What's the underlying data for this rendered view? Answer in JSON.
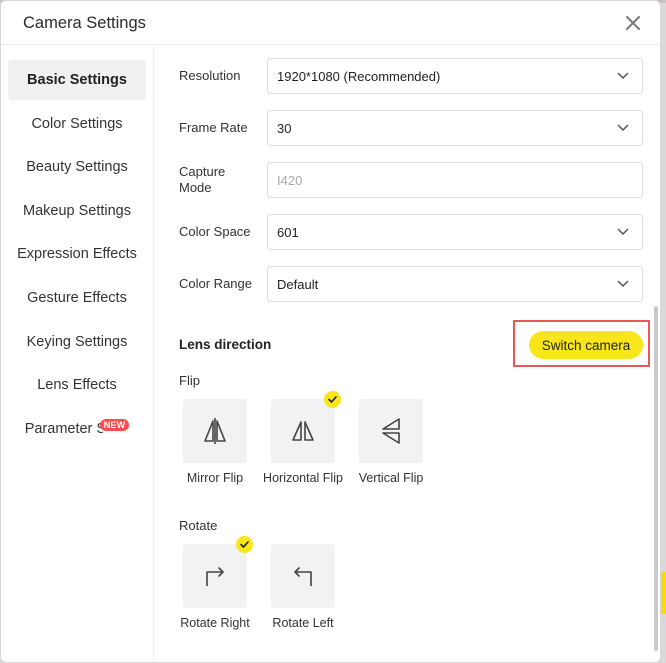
{
  "dialog": {
    "title": "Camera Settings"
  },
  "sidebar": {
    "items": [
      {
        "label": "Basic Settings"
      },
      {
        "label": "Color Settings"
      },
      {
        "label": "Beauty Settings"
      },
      {
        "label": "Makeup Settings"
      },
      {
        "label": "Expression Effects"
      },
      {
        "label": "Gesture Effects"
      },
      {
        "label": "Keying Settings"
      },
      {
        "label": "Lens Effects"
      },
      {
        "label": "Parameter S",
        "badge": "NEW"
      }
    ],
    "active": "Basic Settings"
  },
  "settings": {
    "resolution": {
      "label": "Resolution",
      "value": "1920*1080 (Recommended)"
    },
    "frame_rate": {
      "label": "Frame Rate",
      "value": "30"
    },
    "capture_mode": {
      "label": "Capture Mode",
      "placeholder": "I420"
    },
    "color_space": {
      "label": "Color Space",
      "value": "601"
    },
    "color_range": {
      "label": "Color Range",
      "value": "Default"
    }
  },
  "lens": {
    "title": "Lens direction",
    "switch_label": "Switch camera",
    "flip_label": "Flip",
    "flip_options": [
      {
        "label": "Mirror Flip",
        "icon": "mirror-flip-icon",
        "selected": false
      },
      {
        "label": "Horizontal Flip",
        "icon": "horizontal-flip-icon",
        "selected": true
      },
      {
        "label": "Vertical Flip",
        "icon": "vertical-flip-icon",
        "selected": false
      }
    ],
    "rotate_label": "Rotate",
    "rotate_options": [
      {
        "label": "Rotate Right",
        "icon": "rotate-right-icon",
        "selected": true
      },
      {
        "label": "Rotate Left",
        "icon": "rotate-left-icon",
        "selected": false
      }
    ]
  },
  "colors": {
    "accent": "#f8e61b",
    "badge": "#ff4d4f",
    "highlight": "#e8575a"
  }
}
